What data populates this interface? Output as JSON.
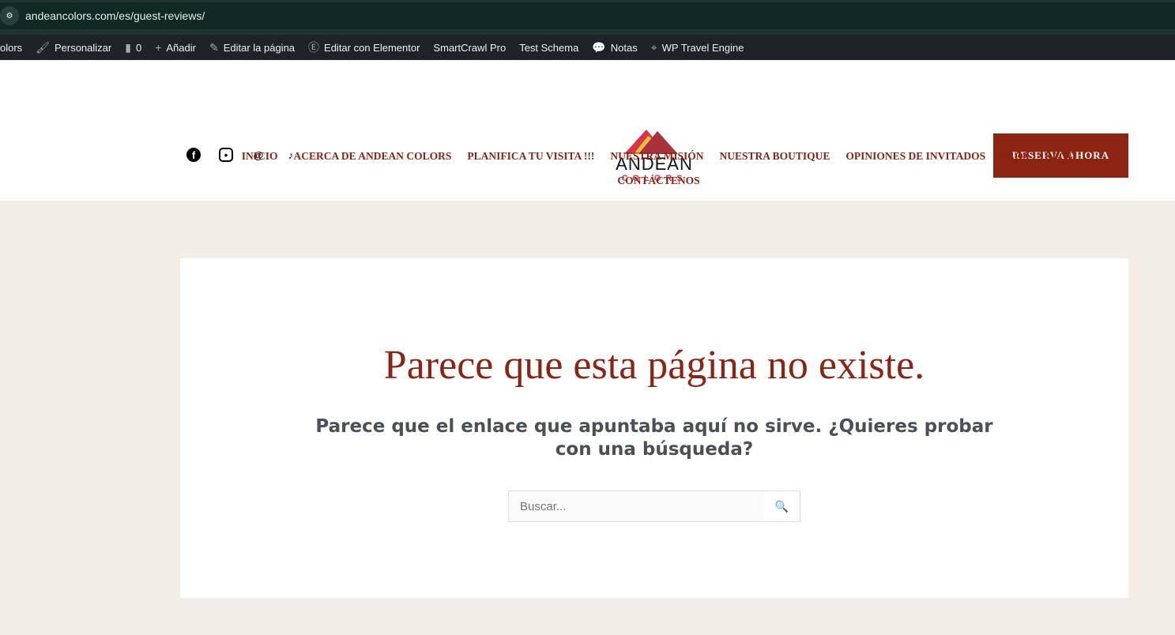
{
  "browser": {
    "url": "andeancolors.com/es/guest-reviews/"
  },
  "adminbar": {
    "items": [
      {
        "icon": "",
        "label": "olors"
      },
      {
        "icon": "brush-icon",
        "glyph": "🖌",
        "label": "Personalizar"
      },
      {
        "icon": "comment-icon",
        "glyph": "▮",
        "label": "0"
      },
      {
        "icon": "plus-icon",
        "glyph": "+",
        "label": "Añadir"
      },
      {
        "icon": "pencil-icon",
        "glyph": "✎",
        "label": "Editar la página"
      },
      {
        "icon": "elementor-icon",
        "glyph": "Ⓔ",
        "label": "Editar con Elementor"
      },
      {
        "icon": "",
        "label": "SmartCrawl Pro"
      },
      {
        "icon": "",
        "label": "Test Schema"
      },
      {
        "icon": "notes-icon",
        "glyph": "💬",
        "label": "Notas"
      },
      {
        "icon": "travel-icon",
        "glyph": "⌖",
        "label": "WP Travel Engine"
      }
    ]
  },
  "header": {
    "logo_top": "ANDEAN",
    "logo_bottom": "COLORS",
    "cta": "RESERVA AHORA",
    "nav": [
      "INICIO",
      "ACERCA DE ANDEAN COLORS",
      "PLANIFICA TU VISITA !!!",
      "NUESTRA MISIÓN",
      "NUESTRA BOUTIQUE",
      "OPINIONES DE INVITADOS",
      "FAQS",
      "BLOG"
    ],
    "nav2": [
      "CONTÁCTENOS"
    ]
  },
  "main": {
    "title": "Parece que esta página no existe.",
    "subtitle": "Parece que el enlace que apuntaba aquí no sirve. ¿Quieres probar con una búsqueda?",
    "search_placeholder": "Buscar..."
  },
  "colors": {
    "brand": "#8b2412",
    "cream": "#f2ede6"
  }
}
